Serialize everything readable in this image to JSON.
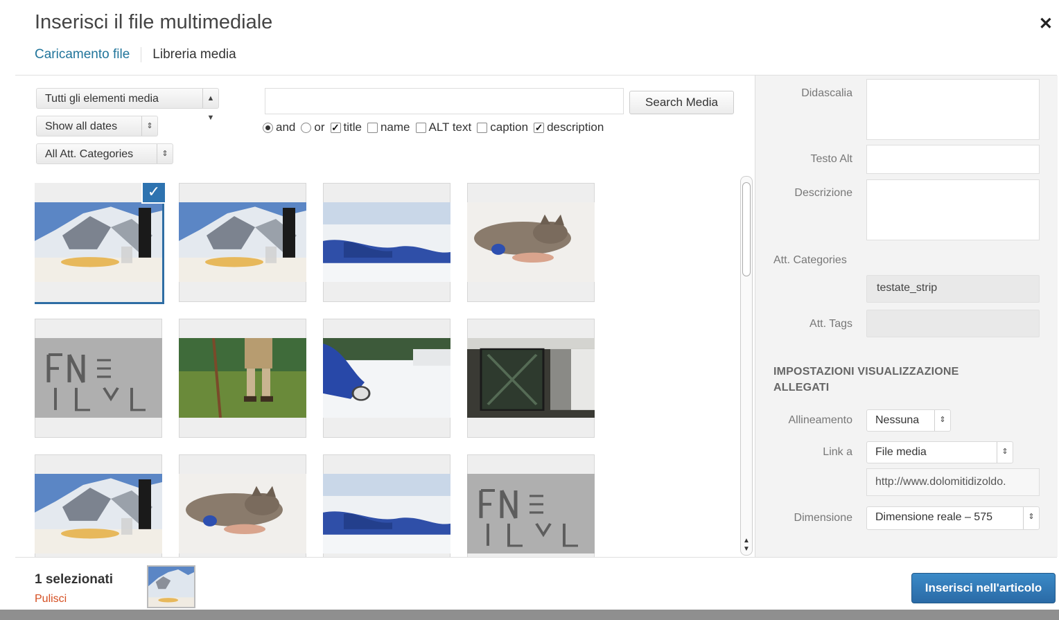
{
  "modal": {
    "title": "Inserisci il file multimediale",
    "close_icon": "close-icon",
    "tabs": [
      {
        "label": "Caricamento file",
        "active": true
      },
      {
        "label": "Libreria media",
        "active": false
      }
    ]
  },
  "filters": {
    "type_select": "Tutti gli elementi media",
    "date_select": "Show all dates",
    "category_select": "All Att. Categories",
    "search_value": "",
    "search_button": "Search Media",
    "options": [
      {
        "kind": "radio",
        "label": "and",
        "checked": true
      },
      {
        "kind": "radio",
        "label": "or",
        "checked": false
      },
      {
        "kind": "checkbox",
        "label": "title",
        "checked": true
      },
      {
        "kind": "checkbox",
        "label": "name",
        "checked": false
      },
      {
        "kind": "checkbox",
        "label": "ALT text",
        "checked": false
      },
      {
        "kind": "checkbox",
        "label": "caption",
        "checked": false
      },
      {
        "kind": "checkbox",
        "label": "description",
        "checked": true
      }
    ]
  },
  "grid": {
    "items": [
      {
        "scene": "mountain-dinner",
        "selected": true
      },
      {
        "scene": "mountain-dinner",
        "selected": false
      },
      {
        "scene": "snow-person",
        "selected": false
      },
      {
        "scene": "cat",
        "selected": false
      },
      {
        "scene": "stone-carving",
        "selected": false
      },
      {
        "scene": "forest-hiker",
        "selected": false
      },
      {
        "scene": "snow-skier",
        "selected": false
      },
      {
        "scene": "wooden-door",
        "selected": false
      },
      {
        "scene": "mountain-dinner",
        "selected": false
      },
      {
        "scene": "cat",
        "selected": false
      },
      {
        "scene": "snow-person",
        "selected": false
      },
      {
        "scene": "stone-carving",
        "selected": false
      }
    ]
  },
  "details": {
    "caption_label": "Didascalia",
    "alt_label": "Testo Alt",
    "description_label": "Descrizione",
    "categories_label": "Att. Categories",
    "categories_value": "testate_strip",
    "tags_label": "Att. Tags",
    "section_title": "IMPOSTAZIONI VISUALIZZAZIONE ALLEGATI",
    "alignment_label": "Allineamento",
    "alignment_value": "Nessuna",
    "link_label": "Link a",
    "link_value": "File media",
    "link_url": "http://www.dolomitidizoldo.",
    "size_label": "Dimensione",
    "size_value": "Dimensione reale – 575"
  },
  "footer": {
    "selected_count": "1 selezionati",
    "clear_label": "Pulisci",
    "insert_button": "Inserisci nell'articolo"
  },
  "colors": {
    "accent": "#21759b",
    "selection": "#2e73b0",
    "clear_link": "#d54e21",
    "insert_button": "#2a6aa6"
  }
}
